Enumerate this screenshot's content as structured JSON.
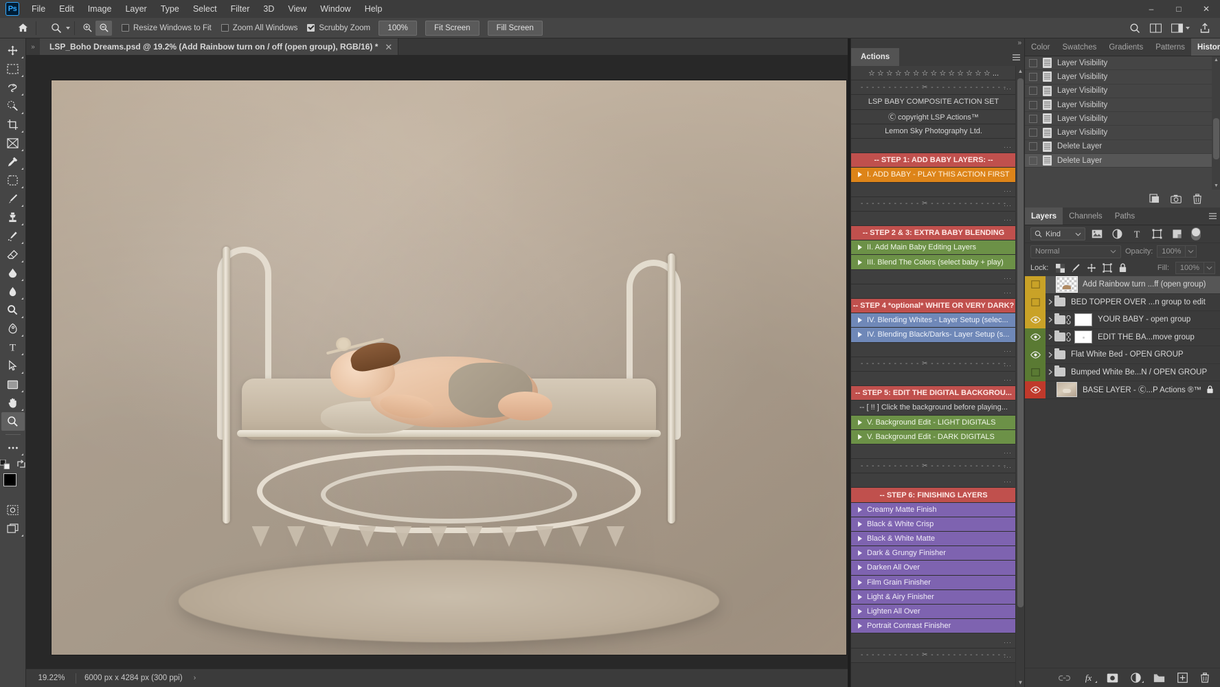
{
  "app": {
    "name": "Photoshop",
    "logo_text": "Ps"
  },
  "menubar": {
    "items": [
      "File",
      "Edit",
      "Image",
      "Layer",
      "Type",
      "Select",
      "Filter",
      "3D",
      "View",
      "Window",
      "Help"
    ],
    "window_controls": {
      "minimize": "–",
      "maximize": "□",
      "close": "✕"
    }
  },
  "options_bar": {
    "home_icon": "home-icon",
    "tool_icon": "zoom-tool-icon",
    "zoom_in_label": "zoom-in-icon",
    "zoom_out_label": "zoom-out-icon",
    "checkboxes": [
      {
        "label": "Resize Windows to Fit",
        "checked": false
      },
      {
        "label": "Zoom All Windows",
        "checked": false
      },
      {
        "label": "Scrubby Zoom",
        "checked": true
      }
    ],
    "buttons": [
      "100%",
      "Fit Screen",
      "Fill Screen"
    ],
    "right_icons": [
      "search-icon",
      "arrange-documents-icon",
      "workspace-switcher-icon",
      "share-icon"
    ]
  },
  "toolbar": {
    "tools": [
      {
        "name": "move-tool",
        "glyph": "move"
      },
      {
        "name": "marquee-tool",
        "glyph": "marquee"
      },
      {
        "name": "lasso-tool",
        "glyph": "lasso"
      },
      {
        "name": "quick-selection-tool",
        "glyph": "quickselect"
      },
      {
        "name": "crop-tool",
        "glyph": "crop"
      },
      {
        "name": "frame-tool",
        "glyph": "frame"
      },
      {
        "name": "eyedropper-tool",
        "glyph": "eyedropper"
      },
      {
        "name": "spot-healing-brush-tool",
        "glyph": "healing"
      },
      {
        "name": "brush-tool",
        "glyph": "brush"
      },
      {
        "name": "clone-stamp-tool",
        "glyph": "stamp"
      },
      {
        "name": "history-brush-tool",
        "glyph": "historybrush"
      },
      {
        "name": "eraser-tool",
        "glyph": "eraser"
      },
      {
        "name": "gradient-tool",
        "glyph": "gradient"
      },
      {
        "name": "blur-tool",
        "glyph": "blur"
      },
      {
        "name": "dodge-tool",
        "glyph": "dodge"
      },
      {
        "name": "pen-tool",
        "glyph": "pen"
      },
      {
        "name": "type-tool",
        "glyph": "type"
      },
      {
        "name": "path-selection-tool",
        "glyph": "pathselect"
      },
      {
        "name": "rectangle-tool",
        "glyph": "rectangle"
      },
      {
        "name": "hand-tool",
        "glyph": "hand"
      },
      {
        "name": "zoom-tool",
        "glyph": "zoom",
        "selected": true
      },
      {
        "name": "edit-toolbar-button",
        "glyph": "dots"
      }
    ],
    "foreground_color": "#000000",
    "background_color": "#ffffff"
  },
  "document": {
    "tab_title": "LSP_Boho Dreams.psd @ 19.2% (Add Rainbow turn on / off  (open group), RGB/16) *",
    "close_label": "✕"
  },
  "status_bar": {
    "zoom": "19.22%",
    "doc_info": "6000 px x 4284 px (300 ppi)",
    "arrow": "›"
  },
  "actions_panel": {
    "tab": "Actions",
    "collapse_label": "»",
    "rows": [
      {
        "text": "☆ ☆ ☆ ☆ ☆ ☆ ☆ ☆ ☆ ☆ ☆ ☆ ☆ ☆ ...",
        "style": "label"
      },
      {
        "text": "- - - - - - - - - - - ✂ - - - - - - - - - - - - - -",
        "style": "dashed",
        "dots": true
      },
      {
        "text": "LSP BABY COMPOSITE ACTION SET",
        "style": "label"
      },
      {
        "text": "Ⓒ copyright LSP Actions™",
        "style": "label"
      },
      {
        "text": "Lemon Sky Photography Ltd.",
        "style": "label"
      },
      {
        "text": "",
        "style": "blank",
        "dots": true
      },
      {
        "text": "-- STEP 1: ADD BABY LAYERS: --",
        "style": "red"
      },
      {
        "text": "I. ADD BABY - PLAY THIS ACTION FIRST",
        "style": "orange",
        "play": true
      },
      {
        "text": "",
        "style": "blank",
        "dots": true
      },
      {
        "text": "- - - - - - - - - - - ✂ - - - - - - - - - - - - - -",
        "style": "dashed",
        "dots": true
      },
      {
        "text": "",
        "style": "blank",
        "dots": true
      },
      {
        "text": "-- STEP 2 & 3: EXTRA BABY BLENDING",
        "style": "red"
      },
      {
        "text": "II.  Add Main Baby Editing Layers",
        "style": "green",
        "play": true
      },
      {
        "text": "III. Blend The Colors (select baby + play)",
        "style": "green",
        "play": true
      },
      {
        "text": "",
        "style": "blank",
        "dots": true
      },
      {
        "text": "",
        "style": "blank",
        "dots": true
      },
      {
        "text": "-- STEP 4 *optional* WHITE OR VERY DARK?",
        "style": "red"
      },
      {
        "text": "IV. Blending Whites - Layer Setup (selec...",
        "style": "blue",
        "play": true
      },
      {
        "text": "IV. Blending Black/Darks- Layer Setup (s...",
        "style": "blue",
        "play": true
      },
      {
        "text": "",
        "style": "blank",
        "dots": true
      },
      {
        "text": "- - - - - - - - - - - ✂ - - - - - - - - - - - - - -",
        "style": "dashed",
        "dots": true
      },
      {
        "text": "",
        "style": "blank",
        "dots": true
      },
      {
        "text": "-- STEP 5: EDIT THE DIGITAL BACKGROU...",
        "style": "red"
      },
      {
        "text": "-- [ !! ] Click the background before playing...",
        "style": "label"
      },
      {
        "text": "V. Background Edit - LIGHT DIGITALS",
        "style": "green",
        "play": true
      },
      {
        "text": "V. Background Edit - DARK DIGITALS",
        "style": "green",
        "play": true
      },
      {
        "text": "",
        "style": "blank",
        "dots": true
      },
      {
        "text": "- - - - - - - - - - - ✂ - - - - - - - - - - - - - -",
        "style": "dashed",
        "dots": true
      },
      {
        "text": "",
        "style": "blank",
        "dots": true
      },
      {
        "text": "-- STEP 6: FINISHING LAYERS",
        "style": "red"
      },
      {
        "text": "Creamy Matte Finish",
        "style": "purple",
        "play": true
      },
      {
        "text": "Black & White Crisp",
        "style": "purple",
        "play": true
      },
      {
        "text": "Black & White Matte",
        "style": "purple",
        "play": true
      },
      {
        "text": "Dark & Grungy Finisher",
        "style": "purple",
        "play": true
      },
      {
        "text": "Darken All Over",
        "style": "purple",
        "play": true
      },
      {
        "text": "Film Grain Finisher",
        "style": "purple",
        "play": true
      },
      {
        "text": "Light & Airy Finisher",
        "style": "purple",
        "play": true
      },
      {
        "text": "Lighten All Over",
        "style": "purple",
        "play": true
      },
      {
        "text": "Portrait Contrast Finisher",
        "style": "purple",
        "play": true
      },
      {
        "text": "",
        "style": "blank",
        "dots": true
      },
      {
        "text": "- - - - - - - - - - - ✂ - - - - - - - - - - - - - -",
        "style": "dashed",
        "dots": true
      }
    ]
  },
  "history_panel": {
    "tabs": [
      {
        "label": "Color",
        "active": false
      },
      {
        "label": "Swatches",
        "active": false
      },
      {
        "label": "Gradients",
        "active": false
      },
      {
        "label": "Patterns",
        "active": false
      },
      {
        "label": "History",
        "active": true
      }
    ],
    "states": [
      {
        "label": "Layer Visibility",
        "selected": false
      },
      {
        "label": "Layer Visibility",
        "selected": false
      },
      {
        "label": "Layer Visibility",
        "selected": false
      },
      {
        "label": "Layer Visibility",
        "selected": false
      },
      {
        "label": "Layer Visibility",
        "selected": false
      },
      {
        "label": "Layer Visibility",
        "selected": false
      },
      {
        "label": "Delete Layer",
        "selected": false
      },
      {
        "label": "Delete Layer",
        "selected": true
      }
    ],
    "buttons": [
      "create-document-from-state-icon",
      "create-new-snapshot-icon",
      "delete-state-icon"
    ]
  },
  "layers_panel": {
    "tabs": [
      {
        "label": "Layers",
        "active": true
      },
      {
        "label": "Channels",
        "active": false
      },
      {
        "label": "Paths",
        "active": false
      }
    ],
    "filter": {
      "kind_label": "Kind",
      "icons": [
        "filter-pixel-icon",
        "filter-adjustment-icon",
        "filter-type-icon",
        "filter-shape-icon",
        "filter-smart-object-icon"
      ],
      "toggle": "filter-enable-toggle"
    },
    "blend_mode": "Normal",
    "opacity_label": "Opacity:",
    "opacity_value": "100%",
    "lock_label": "Lock:",
    "lock_icons": [
      "lock-transparency-icon",
      "lock-image-icon",
      "lock-position-icon",
      "lock-artboard-icon",
      "lock-all-icon"
    ],
    "fill_label": "Fill:",
    "fill_value": "100%",
    "layers": [
      {
        "name": "Add Rainbow turn ...ff  (open group)",
        "visible": false,
        "selected": true,
        "color": "#c9a227",
        "type": "pixel",
        "thumb": "checker",
        "expandable": false
      },
      {
        "name": "BED TOPPER OVER ...n group to edit",
        "visible": false,
        "selected": false,
        "color": "#c9a227",
        "type": "group",
        "expandable": true
      },
      {
        "name": "YOUR BABY - open group",
        "visible": true,
        "selected": false,
        "color": "#c9a227",
        "type": "group",
        "expandable": true,
        "linked": true,
        "mask": "white"
      },
      {
        "name": "EDIT THE BA...move group",
        "visible": true,
        "selected": false,
        "color": "#5a7a33",
        "type": "group",
        "expandable": true,
        "linked": true,
        "mask": "white-dot"
      },
      {
        "name": "Flat White Bed - OPEN GROUP",
        "visible": true,
        "selected": false,
        "color": "#5a7a33",
        "type": "group",
        "expandable": true
      },
      {
        "name": "Bumped White Be...N / OPEN GROUP",
        "visible": false,
        "selected": false,
        "color": "#5a7a33",
        "type": "group",
        "expandable": true
      },
      {
        "name": "BASE LAYER - Ⓒ...P Actions ®™",
        "visible": true,
        "selected": false,
        "color": "#c0392b",
        "type": "pixel",
        "thumb": "image",
        "locked": true,
        "expandable": false
      }
    ],
    "buttons": [
      "link-layers-icon",
      "layer-style-icon",
      "layer-mask-icon",
      "adjustment-layer-icon",
      "new-group-icon",
      "new-layer-icon",
      "delete-layer-icon"
    ]
  },
  "colors": {
    "panel_bg": "#3b3b3b",
    "canvas_bg": "#282828",
    "accent_red": "#c0504d",
    "accent_orange": "#dd8419",
    "accent_green": "#6c9147",
    "accent_blue": "#6f88b8",
    "accent_purple": "#7e63b0"
  }
}
